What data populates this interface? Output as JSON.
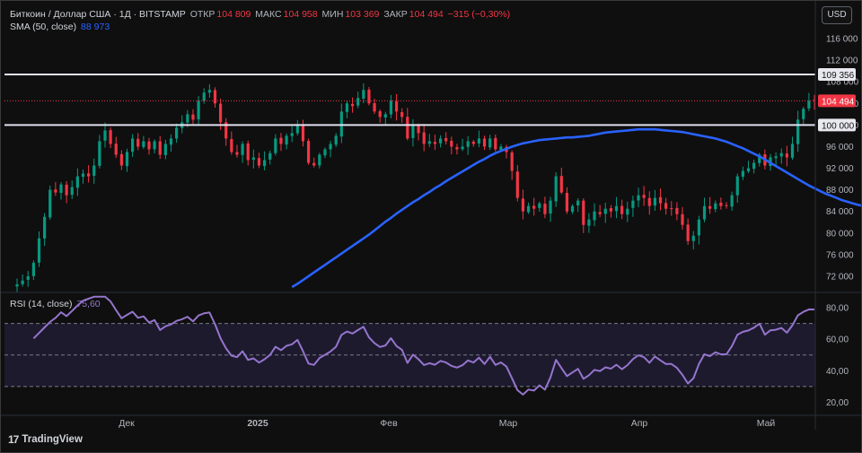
{
  "header": {
    "symbol": "Биткоин / Доллар США · 1Д · BITSTAMP",
    "open_label": "ОТКР",
    "open_value": "104 809",
    "high_label": "МАКС",
    "high_value": "104 958",
    "low_label": "МИН",
    "low_value": "103 369",
    "close_label": "ЗАКР",
    "close_value": "104 494",
    "change": "−315 (−0,30%)"
  },
  "sma": {
    "label": "SMA (50, close)",
    "value": "88 973"
  },
  "rsi_panel": {
    "label": "RSI (14, close)",
    "value": "75,60"
  },
  "currency": "USD",
  "brand": {
    "name": "TradingView"
  },
  "colors": {
    "up": "#089981",
    "down": "#f23645",
    "sma": "#2962ff",
    "rsi": "#9575cd",
    "level_line": "#e1e1f0",
    "price_tag": "#f23645"
  },
  "chart_data": {
    "type": "candlestick",
    "price_axis": {
      "ticks": [
        "116 000",
        "112 000",
        "108 000",
        "104 000",
        "100 000",
        "96 000",
        "92 000",
        "88 000",
        "84 000",
        "80 000",
        "76 000",
        "72 000"
      ],
      "range": [
        69500,
        118000
      ]
    },
    "time_axis": {
      "labels": [
        "Дек",
        "2025",
        "Фев",
        "Мар",
        "Апр",
        "Май"
      ]
    },
    "horizontal_levels": [
      {
        "label": "109 356",
        "value": 109356
      },
      {
        "label": "100 000",
        "value": 100000
      }
    ],
    "last_price": {
      "label": "104 494",
      "value": 104494
    },
    "close_series": [
      70500,
      71200,
      72000,
      74500,
      79000,
      83000,
      88000,
      87500,
      89000,
      87000,
      88500,
      90500,
      91000,
      90500,
      92500,
      97000,
      99000,
      96500,
      94500,
      92500,
      95000,
      97500,
      96000,
      97000,
      95500,
      97000,
      94500,
      96500,
      97500,
      99500,
      100500,
      102000,
      101000,
      104500,
      106000,
      106500,
      104000,
      100500,
      97500,
      95000,
      94500,
      96500,
      93500,
      94000,
      92500,
      93500,
      94800,
      97500,
      96500,
      98000,
      98500,
      100000,
      97000,
      93000,
      92500,
      94500,
      95500,
      96500,
      98000,
      102500,
      104000,
      103500,
      105000,
      106500,
      104000,
      102500,
      101500,
      102000,
      104500,
      102500,
      101500,
      97500,
      100000,
      98500,
      96500,
      97000,
      96500,
      97500,
      97000,
      96000,
      95500,
      96000,
      97000,
      96500,
      97500,
      96000,
      97500,
      95500,
      96000,
      95000,
      91500,
      86500,
      84000,
      85000,
      84500,
      85500,
      83500,
      86000,
      90500,
      87500,
      84000,
      85000,
      86000,
      81500,
      82500,
      84000,
      83500,
      84500,
      84000,
      85000,
      83500,
      84500,
      86000,
      87000,
      86500,
      85000,
      86500,
      85500,
      84500,
      84500,
      83500,
      81500,
      78500,
      79500,
      82500,
      85000,
      84500,
      85500,
      85000,
      85000,
      87000,
      90500,
      91500,
      92000,
      93000,
      94500,
      92500,
      94000,
      94200,
      94800,
      94000,
      96500,
      101000,
      103000,
      104500,
      104494
    ],
    "sma_series": {
      "name": "SMA (50, close)",
      "start_index": 50,
      "values": [
        70000,
        70600,
        71300,
        72000,
        72700,
        73400,
        74100,
        74800,
        75500,
        76200,
        76900,
        77600,
        78300,
        79000,
        79700,
        80500,
        81300,
        82100,
        82800,
        83600,
        84300,
        85000,
        85700,
        86300,
        87000,
        87600,
        88300,
        88900,
        89600,
        90200,
        90800,
        91400,
        92000,
        92600,
        93200,
        93700,
        94300,
        94800,
        95200,
        95600,
        96000,
        96300,
        96600,
        96800,
        97000,
        97200,
        97300,
        97400,
        97500,
        97600,
        97700,
        97700,
        97800,
        97900,
        98000,
        98200,
        98400,
        98600,
        98700,
        98800,
        98900,
        99000,
        99100,
        99200,
        99200,
        99200,
        99200,
        99100,
        99000,
        98900,
        98800,
        98700,
        98500,
        98300,
        98100,
        97900,
        97700,
        97500,
        97200,
        96900,
        96500,
        96100,
        95700,
        95200,
        94700,
        94200,
        93600,
        93000,
        92400,
        91800,
        91200,
        90600,
        90000,
        89400,
        88800,
        88300,
        87800,
        87300,
        86900,
        86500,
        86100,
        85800,
        85500,
        85200,
        85000,
        84800,
        84600,
        84400,
        84300,
        84200,
        84100,
        84000,
        84000,
        84000,
        84100,
        84200,
        84300,
        84400,
        84500,
        84800,
        85000,
        85300,
        85600,
        86000,
        86400,
        86900,
        87300,
        87700,
        88200,
        88700,
        88973
      ]
    },
    "rsi": {
      "label": "RSI (14, close)",
      "levels": [
        70,
        50,
        30
      ],
      "ticks": [
        "80,00",
        "60,00",
        "40,00",
        "20,00"
      ],
      "range": [
        14,
        88
      ],
      "last": 75.6
    }
  }
}
